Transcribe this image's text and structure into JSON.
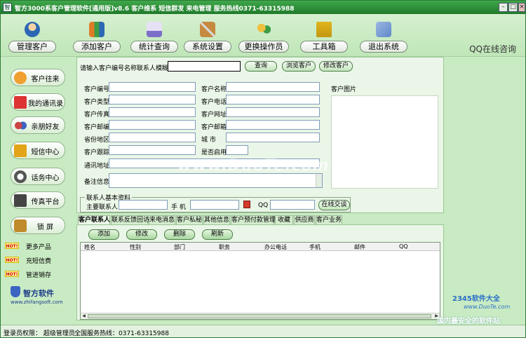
{
  "window": {
    "title": "智方3000系客户管理软件[通用版]v8.6  客户维系 短信群发 来电管理  服务热线0371-63315988",
    "app_icon": "智"
  },
  "toolbar": {
    "buttons": [
      {
        "label": "管理客户",
        "icon": "person-icon",
        "color": "#2c67b3"
      },
      {
        "label": "添加客户",
        "icon": "group-add-icon",
        "color": "#e07b28"
      },
      {
        "label": "统计查询",
        "icon": "chart-icon",
        "color": "#7b6fc9"
      },
      {
        "label": "系统设置",
        "icon": "tools-icon",
        "color": "#c58a3f"
      },
      {
        "label": "更换操作员",
        "icon": "users-icon",
        "color": "#e0b030"
      },
      {
        "label": "工具箱",
        "icon": "toolbox-icon",
        "color": "#e2b51f"
      },
      {
        "label": "退出系统",
        "icon": "exit-icon",
        "color": "#5f88c8"
      }
    ],
    "qq_link": "QQ在线咨询"
  },
  "sidebar": {
    "items": [
      {
        "label": "客户往来",
        "icon": "handshake-icon",
        "color": "#f0a030"
      },
      {
        "label": "我的通讯录",
        "icon": "address-book-icon",
        "color": "#d33"
      },
      {
        "label": "亲朋好友",
        "icon": "friends-icon",
        "color": "#c44"
      },
      {
        "label": "短信中心",
        "icon": "mail-icon",
        "color": "#e3a41a"
      },
      {
        "label": "话务中心",
        "icon": "phone-icon",
        "color": "#555"
      },
      {
        "label": "传真平台",
        "icon": "fax-icon",
        "color": "#444"
      },
      {
        "label": "锁    屏",
        "icon": "lock-icon",
        "color": "#c08b2a"
      }
    ],
    "extras": [
      {
        "badge": "HOT!",
        "label": "更多产品"
      },
      {
        "badge": "HOT!",
        "label": "充短信费"
      },
      {
        "badge": "HOT!",
        "label": "管进销存"
      }
    ],
    "brand": {
      "name": "智方软件",
      "url": "www.zhifangsoft.com"
    }
  },
  "search": {
    "label": "请输入客户编号名称联系人模糊查询",
    "value": "",
    "search_button": "查询",
    "browse_button": "浏览客户",
    "edit_button": "修改客户"
  },
  "form": {
    "fields_left": [
      {
        "label": "客户编号",
        "value": ""
      },
      {
        "label": "客户类型",
        "value": ""
      },
      {
        "label": "客户传真",
        "value": ""
      },
      {
        "label": "客户邮编",
        "value": ""
      },
      {
        "label": "省份地区",
        "value": ""
      },
      {
        "label": "客户跟踪",
        "value": ""
      }
    ],
    "fields_right": [
      {
        "label": "客户名称",
        "value": ""
      },
      {
        "label": "客户电话",
        "value": ""
      },
      {
        "label": "客户网址",
        "value": ""
      },
      {
        "label": "客户邮箱",
        "value": ""
      },
      {
        "label": "城    市",
        "value": ""
      },
      {
        "label": "是否启用",
        "value": ""
      }
    ],
    "address_label": "通讯地址",
    "address_value": "",
    "notes_label": "备注信息",
    "notes_value": "",
    "photo_label": "客户图片"
  },
  "contact": {
    "group_title": "联系人基本资料",
    "main_contact_label": "主要联系人",
    "main_contact_value": "",
    "mobile_label": "手    机",
    "mobile_value": "",
    "qq_label": "QQ",
    "qq_value": "",
    "chat_button": "在线交谈"
  },
  "tabs": [
    {
      "label": "客户联系人",
      "active": true
    },
    {
      "label": "联系反馈回访",
      "active": false
    },
    {
      "label": "来电消息",
      "active": false
    },
    {
      "label": "客户私秘",
      "active": false
    },
    {
      "label": "其他信息",
      "active": false
    },
    {
      "label": "客户预付款管理",
      "active": false
    },
    {
      "label": "收藏",
      "active": false
    },
    {
      "label": "供应商",
      "active": false
    },
    {
      "label": "客户业务",
      "active": false
    }
  ],
  "actions": {
    "add": "添加",
    "edit": "修改",
    "delete": "删除",
    "refresh": "刷新"
  },
  "grid": {
    "columns": [
      "姓名",
      "性别",
      "部门",
      "职务",
      "办公电话",
      "手机",
      "邮件",
      "QQ"
    ],
    "rows": []
  },
  "status": {
    "login_user": "登录员权限： 超级管理员",
    "hotline": "全国服务热线：0371-63315988"
  },
  "watermark": {
    "text": "www.DuoTe.com",
    "badge": "2345软件大全",
    "badge_url": "www.DuoTe.com",
    "tagline": "国内最安全的软件站"
  }
}
